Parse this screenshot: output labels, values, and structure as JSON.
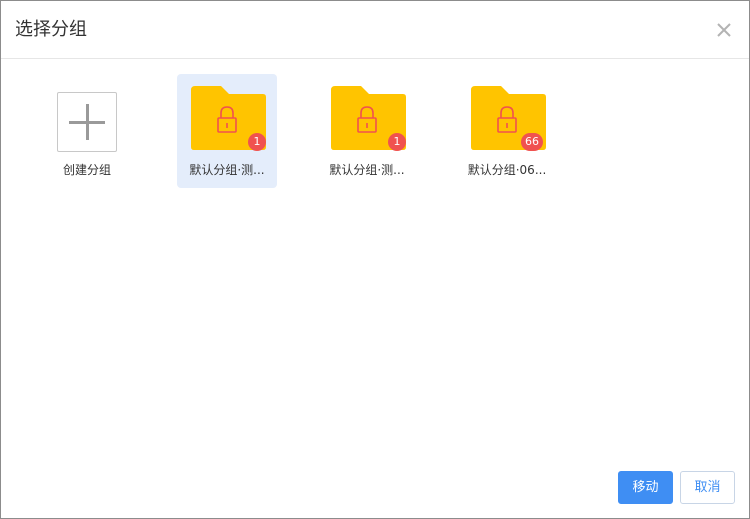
{
  "dialog": {
    "title": "选择分组"
  },
  "tiles": {
    "create_label": "创建分组",
    "folders": [
      {
        "label": "默认分组·测...",
        "count": "1",
        "selected": true
      },
      {
        "label": "默认分组·测...",
        "count": "1",
        "selected": false
      },
      {
        "label": "默认分组·06...",
        "count": "66",
        "selected": false
      }
    ]
  },
  "footer": {
    "move_label": "移动",
    "cancel_label": "取消"
  },
  "colors": {
    "folder": "#ffc400",
    "lock": "#f0524f",
    "badge": "#f0524f",
    "primary": "#3f8ef3",
    "selected_bg": "#e4edfb"
  }
}
